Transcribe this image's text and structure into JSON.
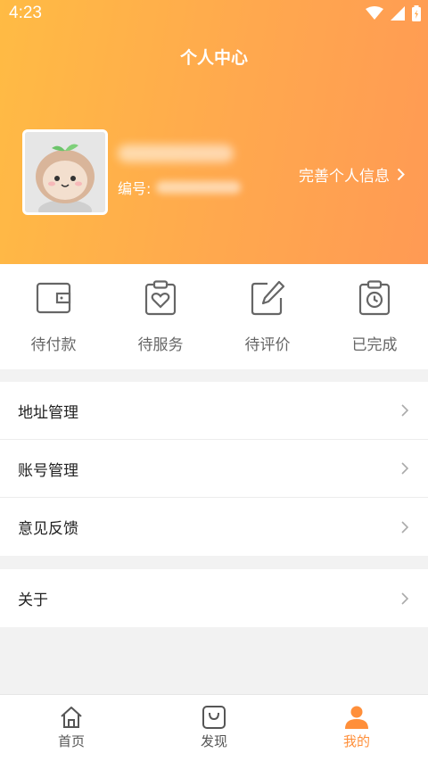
{
  "status": {
    "time": "4:23"
  },
  "header": {
    "title": "个人中心",
    "id_label": "编号:",
    "profile_link": "完善个人信息"
  },
  "orders": [
    {
      "label": "待付款",
      "icon": "wallet-icon"
    },
    {
      "label": "待服务",
      "icon": "clipboard-heart-icon"
    },
    {
      "label": "待评价",
      "icon": "edit-icon"
    },
    {
      "label": "已完成",
      "icon": "clipboard-clock-icon"
    }
  ],
  "menu": [
    {
      "label": "地址管理"
    },
    {
      "label": "账号管理"
    },
    {
      "label": "意见反馈"
    },
    {
      "label": "关于"
    }
  ],
  "tabs": [
    {
      "label": "首页",
      "icon": "home-icon"
    },
    {
      "label": "发现",
      "icon": "shopping-bag-icon"
    },
    {
      "label": "我的",
      "icon": "user-icon"
    }
  ],
  "colors": {
    "accent": "#ff8f3a",
    "header_start": "#ffbb44",
    "header_end": "#ff9a54"
  }
}
